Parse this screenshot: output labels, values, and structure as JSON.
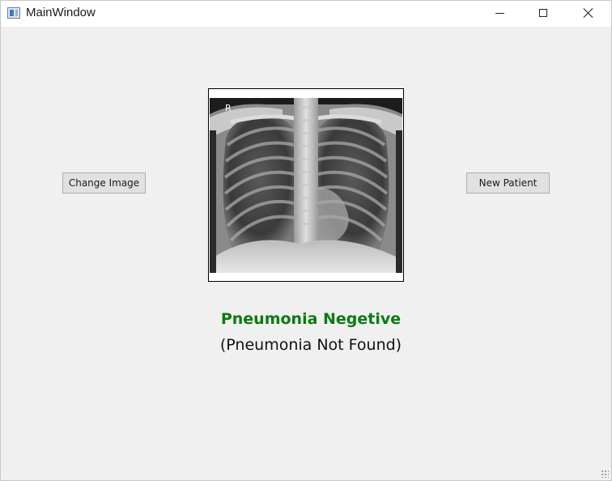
{
  "window": {
    "title": "MainWindow"
  },
  "buttons": {
    "change_image": "Change Image",
    "new_patient": "New Patient"
  },
  "xray": {
    "marker": "R"
  },
  "result": {
    "status": "Pneumonia Negetive",
    "detail": "(Pneumonia Not Found)",
    "status_color": "#0b7a12"
  },
  "icons": {
    "app": "app-window-icon",
    "minimize": "minimize-icon",
    "maximize": "maximize-icon",
    "close": "close-icon",
    "grip": "resize-grip-icon"
  }
}
